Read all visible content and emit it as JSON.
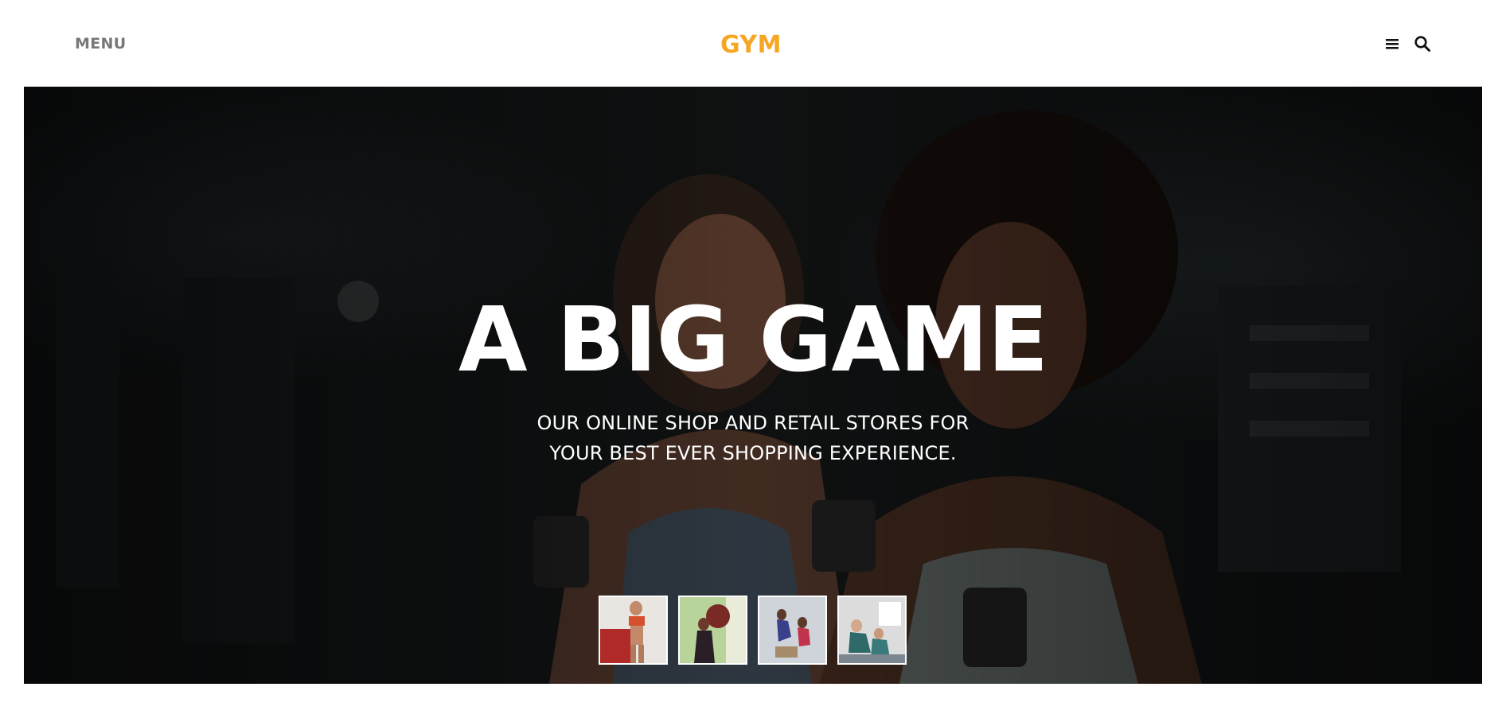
{
  "header": {
    "menu_label": "MENU",
    "logo_text": "GYM",
    "icons": [
      "hamburger-icon",
      "search-icon"
    ]
  },
  "hero": {
    "title": "A BIG GAME",
    "subtitle_line1": "OUR ONLINE SHOP AND RETAIL STORES FOR",
    "subtitle_line2": "YOUR BEST EVER SHOPPING EXPERIENCE.",
    "background_image": "two women smiling and lifting dumbbells in a gym",
    "thumbnails": [
      "woman posing in red sports top",
      "woman training with medicine ball",
      "people jumping onto boxes",
      "group doing floor exercises"
    ]
  },
  "colors": {
    "brand": "#f5a623",
    "menu_text": "#777777",
    "hero_overlay": "#000000"
  }
}
